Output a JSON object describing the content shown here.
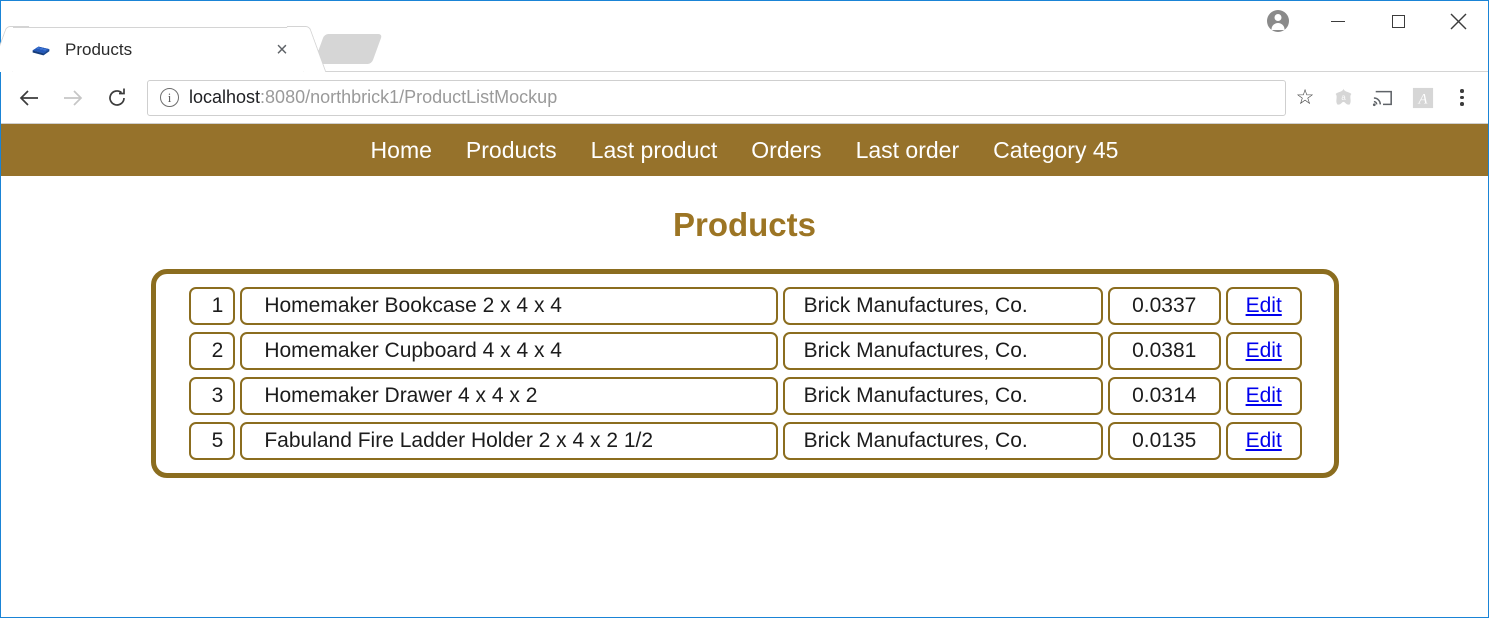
{
  "browser": {
    "tab": {
      "title": "Products",
      "favicon": "lego-brick-icon",
      "close_label": "×"
    },
    "window_controls": {
      "profile": "profile-avatar-icon",
      "minimize": "minimize-icon",
      "maximize": "maximize-icon",
      "close": "✕"
    },
    "toolbar": {
      "back": "←",
      "forward": "→",
      "reload": "↻",
      "info": "i",
      "url_host": "localhost",
      "url_path": ":8080/northbrick1/ProductListMockup",
      "url_full": "localhost:8080/northbrick1/ProductListMockup",
      "star": "☆",
      "extensions": [
        "avast-extension-icon",
        "cast-icon",
        "adobe-pdf-icon"
      ],
      "menu": "three-dot-menu-icon"
    }
  },
  "page": {
    "nav": {
      "items": [
        {
          "label": "Home"
        },
        {
          "label": "Products"
        },
        {
          "label": "Last product"
        },
        {
          "label": "Orders"
        },
        {
          "label": "Last order"
        },
        {
          "label": "Category 45"
        }
      ]
    },
    "title": "Products",
    "table": {
      "rows": [
        {
          "id": "1",
          "name": "Homemaker Bookcase 2 x 4 x 4",
          "manufacturer": "Brick Manufactures, Co.",
          "price": "0.0337",
          "action": "Edit"
        },
        {
          "id": "2",
          "name": "Homemaker Cupboard 4 x 4 x 4",
          "manufacturer": "Brick Manufactures, Co.",
          "price": "0.0381",
          "action": "Edit"
        },
        {
          "id": "3",
          "name": "Homemaker Drawer 4 x 4 x 2",
          "manufacturer": "Brick Manufactures, Co.",
          "price": "0.0314",
          "action": "Edit"
        },
        {
          "id": "5",
          "name": "Fabuland Fire Ladder Holder 2 x 4 x 2 1/2",
          "manufacturer": "Brick Manufactures, Co.",
          "price": "0.0135",
          "action": "Edit"
        }
      ]
    }
  },
  "colors": {
    "brand_brown": "#96722b",
    "border_brown": "#8b6d1f",
    "title_gold": "#9c7524",
    "link_blue": "#0000ee",
    "window_border": "#1a84d6"
  }
}
